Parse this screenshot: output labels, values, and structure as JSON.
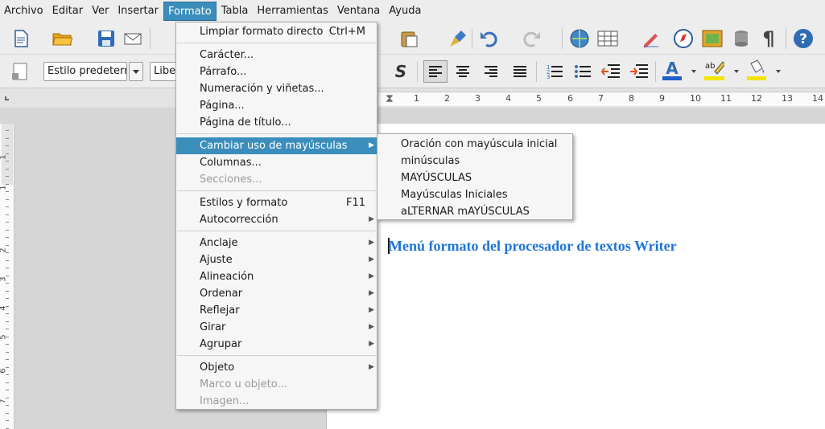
{
  "menubar": [
    {
      "label": "Archivo",
      "key": "A",
      "rest": "rchivo"
    },
    {
      "label": "Editar",
      "key": "E",
      "rest": "ditar"
    },
    {
      "label": "Ver",
      "key": "V",
      "rest": "er"
    },
    {
      "label": "Insertar",
      "key": "I",
      "rest": "nsertar"
    },
    {
      "label": "Formato",
      "key": "F",
      "rest": "ormato"
    },
    {
      "label": "Tabla",
      "key": "T",
      "rest": "abla"
    },
    {
      "label": "Herramientas",
      "key": "H",
      "rest": "erramientas"
    },
    {
      "label": "Ventana",
      "key": "V",
      "rest": "entana"
    },
    {
      "label": "Ayuda",
      "key": "A",
      "rest": "yuda"
    }
  ],
  "toolbar2": {
    "style_value": "Estilo predeterm",
    "font_value": "Libe"
  },
  "ruler_h_labels": [
    "1",
    "2",
    "3",
    "4",
    "5",
    "6",
    "7",
    "8",
    "9",
    "10",
    "11",
    "12",
    "13",
    "14"
  ],
  "ruler_v_labels": [
    "1",
    "1",
    "2",
    "3",
    "4",
    "5",
    "6",
    "7"
  ],
  "format_menu": {
    "items": [
      {
        "label": "Limpiar formato directo",
        "accel": "Ctrl+M"
      },
      {
        "label": "Carácter..."
      },
      {
        "label": "Párrafo..."
      },
      {
        "label": "Numeración y viñetas..."
      },
      {
        "label": "Página..."
      },
      {
        "label": "Página de título..."
      },
      {
        "label": "Cambiar uso de mayúsculas"
      },
      {
        "label": "Columnas..."
      },
      {
        "label": "Secciones..."
      },
      {
        "label": "Estilos y formato",
        "accel": "F11"
      },
      {
        "label": "Autocorrección"
      },
      {
        "label": "Anclaje"
      },
      {
        "label": "Ajuste"
      },
      {
        "label": "Alineación"
      },
      {
        "label": "Ordenar"
      },
      {
        "label": "Reflejar"
      },
      {
        "label": "Girar"
      },
      {
        "label": "Agrupar"
      },
      {
        "label": "Objeto"
      },
      {
        "label": "Marco u objeto..."
      },
      {
        "label": "Imagen..."
      }
    ]
  },
  "case_submenu": {
    "items": [
      {
        "label": "Oración con mayúscula inicial"
      },
      {
        "label": "minúsculas"
      },
      {
        "label": "MAYÚSCULAS"
      },
      {
        "label": "Mayúsculas Iniciales"
      },
      {
        "label": "aLTERNAR mAYÚSCULAS"
      }
    ]
  },
  "document": {
    "text": "Menú formato del procesador de textos Writer",
    "text_color": "#1e74d4"
  },
  "colors": {
    "highlight": "#3b8ebc",
    "font_color_bar": "#1e5fc9",
    "highlight_bar": "#f2e600"
  }
}
